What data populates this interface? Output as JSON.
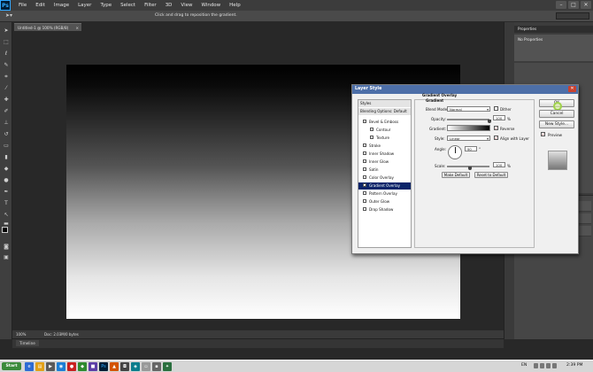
{
  "app": {
    "logo": "Ps",
    "menu": [
      "File",
      "Edit",
      "Image",
      "Layer",
      "Type",
      "Select",
      "Filter",
      "3D",
      "View",
      "Window",
      "Help"
    ],
    "window_controls": [
      "–",
      "□",
      "✕"
    ]
  },
  "options_bar": {
    "tool_icon": "move-icon",
    "hint": "Click and drag to reposition the gradient."
  },
  "document": {
    "tab_title": "Untitled-1 @ 100% (RGB/8)",
    "tab_close": "×",
    "zoom": "100%",
    "info": "Doc: 2.03M/0 bytes"
  },
  "timeline": {
    "label": "Timeline"
  },
  "panels": {
    "properties_title": "Properties",
    "properties_body": "No Properties"
  },
  "dialog": {
    "title": "Layer Style",
    "close": "✕",
    "styles_header": "Styles",
    "blending_options": "Blending Options: Default",
    "styles": [
      {
        "label": "Bevel & Emboss",
        "checked": false,
        "indent": false
      },
      {
        "label": "Contour",
        "checked": false,
        "indent": true
      },
      {
        "label": "Texture",
        "checked": false,
        "indent": true
      },
      {
        "label": "Stroke",
        "checked": false,
        "indent": false
      },
      {
        "label": "Inner Shadow",
        "checked": false,
        "indent": false
      },
      {
        "label": "Inner Glow",
        "checked": false,
        "indent": false
      },
      {
        "label": "Satin",
        "checked": false,
        "indent": false
      },
      {
        "label": "Color Overlay",
        "checked": false,
        "indent": false
      },
      {
        "label": "Gradient Overlay",
        "checked": true,
        "indent": false,
        "selected": true
      },
      {
        "label": "Pattern Overlay",
        "checked": false,
        "indent": false
      },
      {
        "label": "Outer Glow",
        "checked": false,
        "indent": false
      },
      {
        "label": "Drop Shadow",
        "checked": false,
        "indent": false
      }
    ],
    "section_title": "Gradient Overlay",
    "section_subtitle": "Gradient",
    "blend_mode_label": "Blend Mode:",
    "blend_mode_value": "Normal",
    "dither_label": "Dither",
    "opacity_label": "Opacity:",
    "opacity_value": "100",
    "percent": "%",
    "gradient_label": "Gradient:",
    "reverse_label": "Reverse",
    "reverse_checked": true,
    "style_label": "Style:",
    "style_value": "Linear",
    "align_label": "Align with Layer",
    "align_checked": true,
    "angle_label": "Angle:",
    "angle_value": "90",
    "degree": "°",
    "scale_label": "Scale:",
    "scale_value": "100",
    "make_default": "Make Default",
    "reset_default": "Reset to Default",
    "ok": "OK",
    "cancel": "Cancel",
    "new_style": "New Style...",
    "preview_label": "Preview",
    "preview_checked": true
  },
  "taskbar": {
    "start": "Start",
    "lang": "EN",
    "time": "2:39 PM"
  }
}
